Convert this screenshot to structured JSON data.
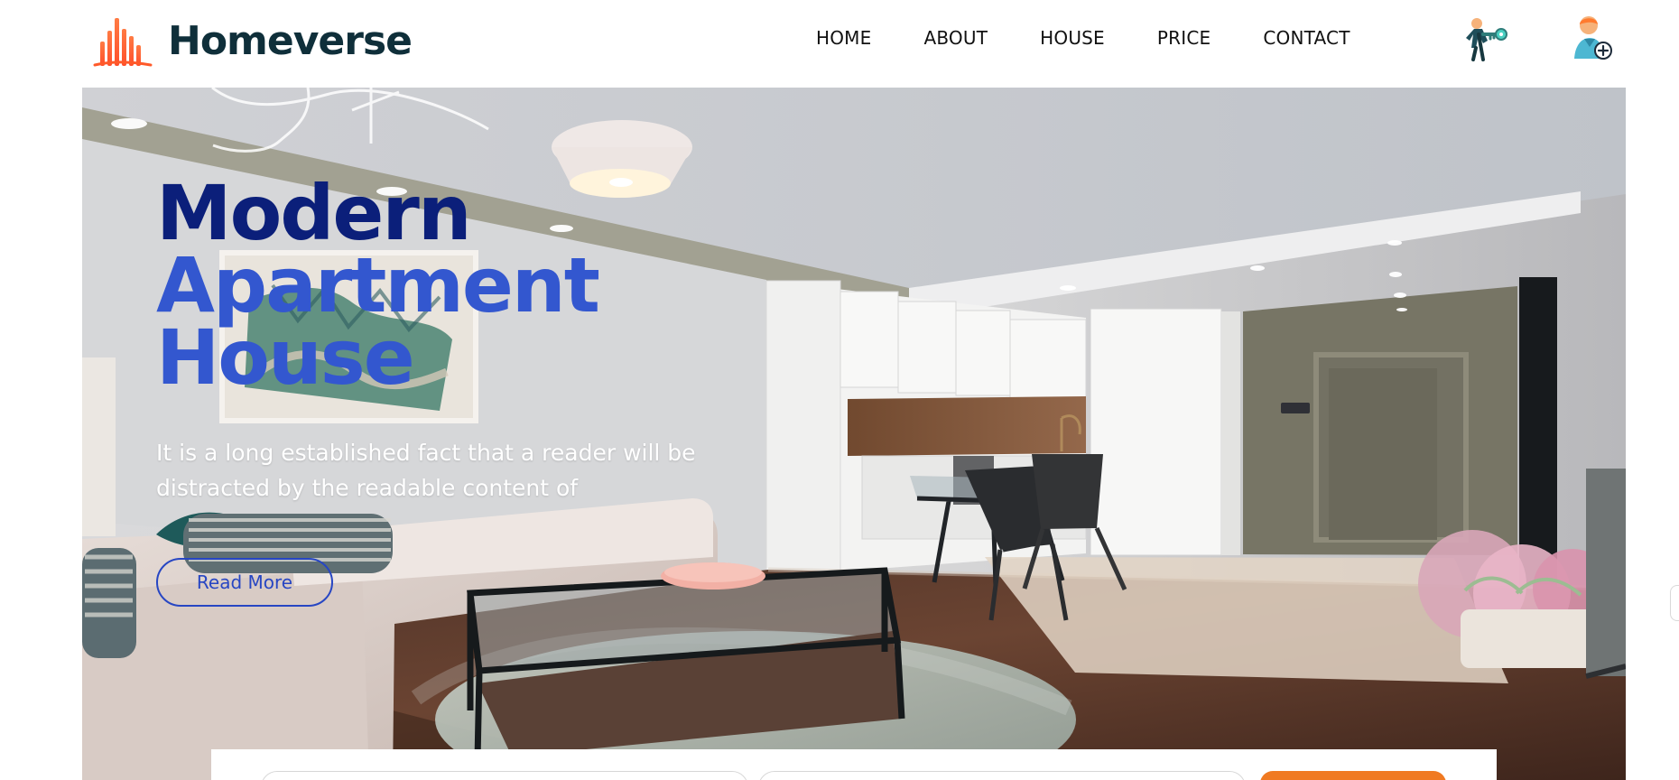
{
  "brand": {
    "name": "Homeverse",
    "logo_icon": "house-bars-logo"
  },
  "nav": {
    "items": [
      {
        "label": "HOME"
      },
      {
        "label": "ABOUT"
      },
      {
        "label": "HOUSE"
      },
      {
        "label": "PRICE"
      },
      {
        "label": "CONTACT"
      }
    ]
  },
  "header_icons": {
    "keys_icon": "key-figure-icon",
    "user_icon": "user-add-icon"
  },
  "hero": {
    "title_line1": "Modern",
    "title_line2": "Apartment",
    "title_line3": "House",
    "description": "It is a long established fact that a reader will be distracted by the readable content of",
    "cta_label": "Read More"
  },
  "colors": {
    "brand_dark": "#0f2f3a",
    "title_dark_blue": "#0b1f7a",
    "title_blue": "#3357cf",
    "button_blue": "#2746c3",
    "accent_orange": "#f07a22",
    "logo_orange": "#ff5a2a"
  }
}
